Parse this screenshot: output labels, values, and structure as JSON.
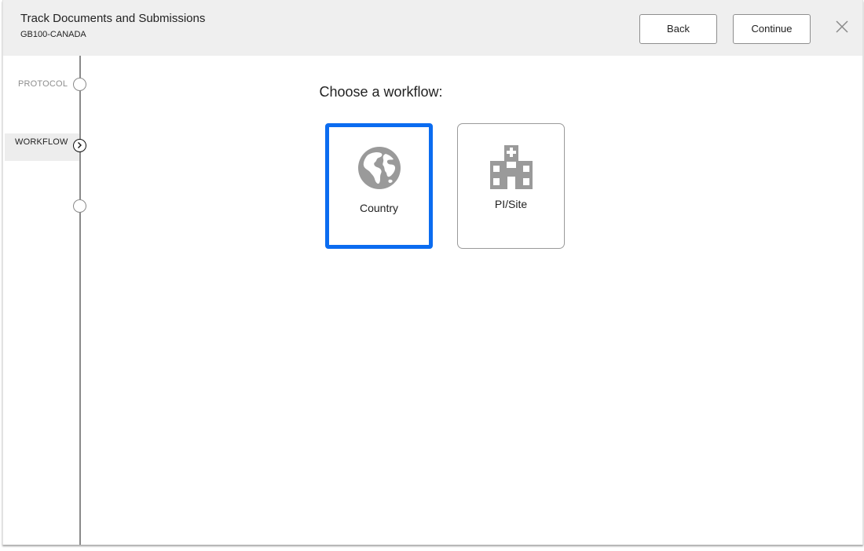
{
  "header": {
    "title": "Track Documents and Submissions",
    "subtitle": "GB100-CANADA",
    "back_label": "Back",
    "continue_label": "Continue",
    "close_icon": "close-icon"
  },
  "stepper": {
    "steps": [
      {
        "label": "PROTOCOL",
        "state": "completed"
      },
      {
        "label": "WORKFLOW",
        "state": "current"
      },
      {
        "label": "",
        "state": "upcoming"
      }
    ]
  },
  "main": {
    "prompt": "Choose a workflow:",
    "options": [
      {
        "label": "Country",
        "icon": "globe-icon",
        "selected": true
      },
      {
        "label": "PI/Site",
        "icon": "hospital-icon",
        "selected": false
      }
    ]
  },
  "colors": {
    "accent": "#0b6cf0",
    "header_bg": "#efefef",
    "icon_gray": "#9a9a9a"
  }
}
